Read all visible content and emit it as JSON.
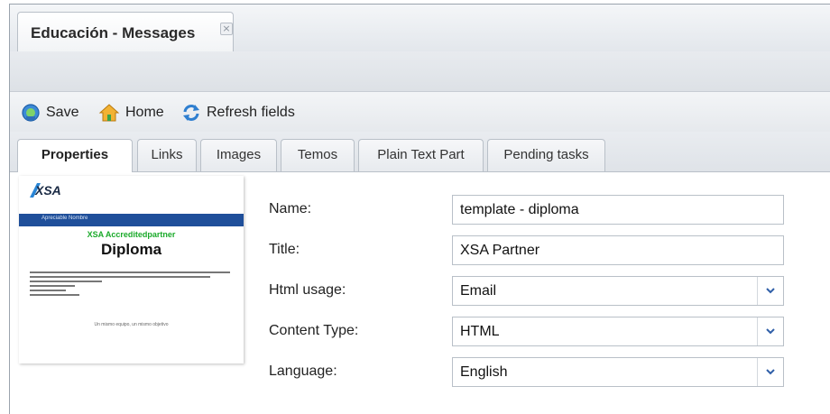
{
  "window": {
    "title": "Educación - Messages",
    "close_symbol": "×"
  },
  "toolbar": {
    "save_label": "Save",
    "home_label": "Home",
    "refresh_label": "Refresh fields"
  },
  "tabs": [
    {
      "label": "Properties",
      "active": true
    },
    {
      "label": "Links"
    },
    {
      "label": "Images"
    },
    {
      "label": "Temos"
    },
    {
      "label": "Plain Text Part"
    },
    {
      "label": "Pending tasks"
    }
  ],
  "preview": {
    "logo": "XSA",
    "bar_text": "Apreciable Nombre",
    "partner_text": "XSA Accreditedpartner",
    "diploma_text": "Diploma",
    "footer_text": "Un mismo equipo, un mismo objetivo"
  },
  "form": {
    "name_label": "Name:",
    "name_value": "template - diploma",
    "title_label": "Title:",
    "title_value": "XSA Partner",
    "html_usage_label": "Html usage:",
    "html_usage_value": "Email",
    "content_type_label": "Content Type:",
    "content_type_value": "HTML",
    "language_label": "Language:",
    "language_value": "English"
  },
  "colors": {
    "accent_blue": "#1f4f9a",
    "partner_green": "#1aaa2a"
  }
}
